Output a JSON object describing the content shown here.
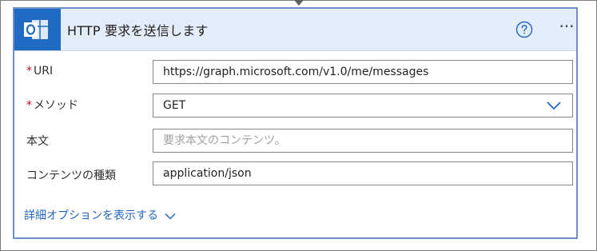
{
  "header": {
    "title": "HTTP 要求を送信します",
    "app_icon": "outlook-icon",
    "help_icon": "question-circle-icon",
    "more_icon": "ellipsis-icon",
    "more_glyph": "···"
  },
  "fields": [
    {
      "label": "URI",
      "required": true,
      "required_mark": "*",
      "value": "https://graph.microsoft.com/v1.0/me/messages",
      "placeholder": ""
    },
    {
      "label": "メソッド",
      "required": true,
      "required_mark": "*",
      "value": "GET",
      "placeholder": "",
      "type": "dropdown"
    },
    {
      "label": "本文",
      "required": false,
      "value": "",
      "placeholder": "要求本文のコンテンツ。"
    },
    {
      "label": "コンテンツの種類",
      "required": false,
      "value": "application/json",
      "placeholder": ""
    }
  ],
  "advanced_options": {
    "label": "詳細オプションを表示する"
  },
  "colors": {
    "accent": "#2266c0",
    "header_bg": "#e3ecf9",
    "card_border": "#6d90c8",
    "outlook_blue": "#1f6bc4",
    "required": "#c50f1f"
  }
}
